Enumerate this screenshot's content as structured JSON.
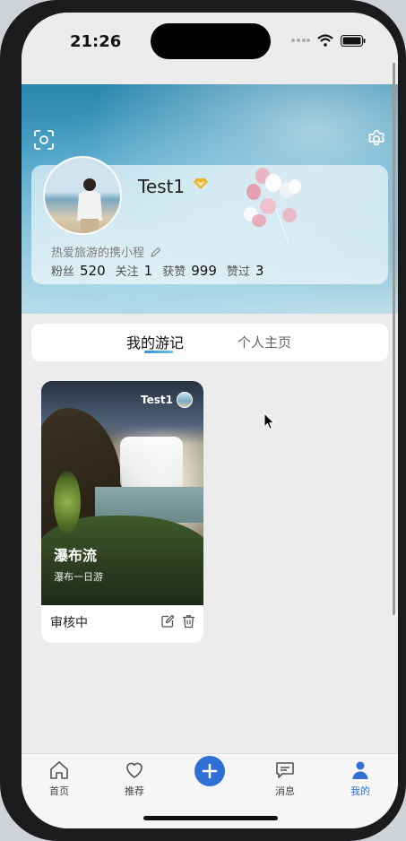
{
  "status_bar": {
    "time": "21:26"
  },
  "profile": {
    "username": "Test1",
    "bio": "热爱旅游的携小程",
    "stats": [
      {
        "label": "粉丝",
        "value": "520"
      },
      {
        "label": "关注",
        "value": "1"
      },
      {
        "label": "获赞",
        "value": "999"
      },
      {
        "label": "赞过",
        "value": "3"
      }
    ]
  },
  "tabs": {
    "travel_notes": "我的游记",
    "homepage": "个人主页",
    "active": "travel_notes"
  },
  "note": {
    "author": "Test1",
    "title": "瀑布流",
    "subtitle": "瀑布一日游",
    "status": "审核中"
  },
  "tabbar": {
    "home": "首页",
    "recommend": "推荐",
    "messages": "消息",
    "me": "我的",
    "active": "me"
  },
  "colors": {
    "accent": "#2f6fd6",
    "vip": "#e8b62c"
  },
  "icons": [
    "scan-icon",
    "gear-icon",
    "vip-diamond-icon",
    "edit-icon",
    "trash-icon",
    "home-icon",
    "heart-icon",
    "plus-icon",
    "chat-icon",
    "user-icon"
  ]
}
